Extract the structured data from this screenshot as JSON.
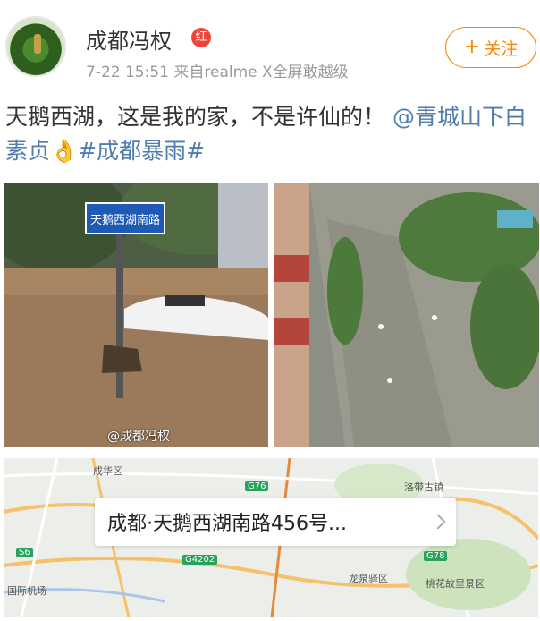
{
  "header": {
    "username": "成都冯权",
    "vip_badge": "红",
    "timestamp": "7-22 15:51",
    "source_prefix": "来自",
    "source": "realme X全屏敢越级",
    "follow_label": "关注",
    "follow_plus": "+"
  },
  "post": {
    "text": "天鹅西湖，这是我的家，不是许仙的！",
    "mention": "@青城山下白素贞",
    "emoji": "👌",
    "hashtag": "#成都暴雨#"
  },
  "photos": {
    "street_sign": "天鹅西湖南路",
    "watermark": "@成都冯权"
  },
  "map": {
    "address": "成都·天鹅西湖南路456号...",
    "labels": {
      "airport": "国际机场",
      "scenic": "桃花故里景区",
      "district": "龙泉驿区",
      "town": "洛带古镇",
      "area": "成华区",
      "road_g4202": "G4202",
      "road_s6": "S6",
      "road_g76": "G76",
      "road_g78": "G78"
    }
  },
  "colors": {
    "accent": "#ff8200",
    "link": "#507daf",
    "vip": "#f0443a"
  }
}
